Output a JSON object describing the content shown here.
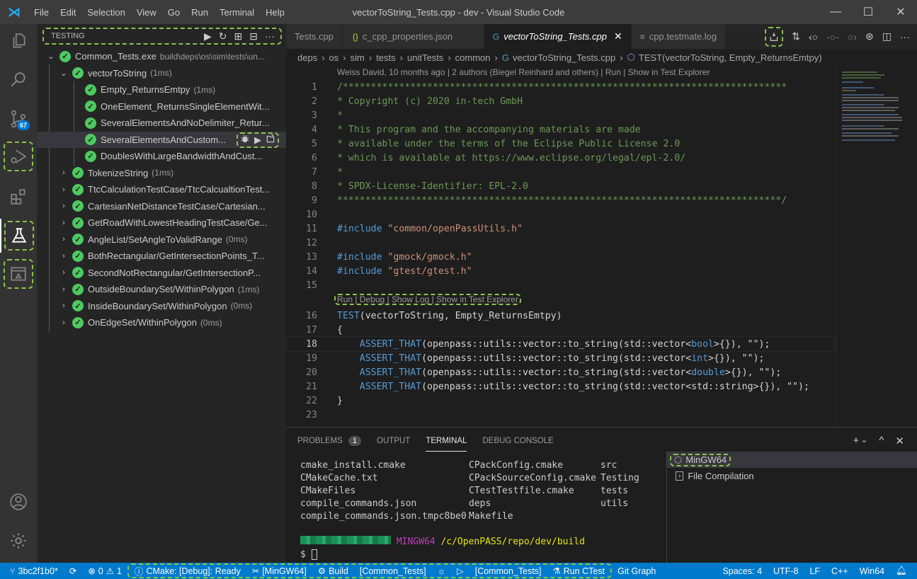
{
  "titlebar": {
    "menu": [
      "File",
      "Edit",
      "Selection",
      "View",
      "Go",
      "Run",
      "Terminal",
      "Help"
    ],
    "title": "vectorToString_Tests.cpp - dev - Visual Studio Code",
    "controls": {
      "minimize": "—",
      "maximize": "☐",
      "close": "✕"
    }
  },
  "activitybar": {
    "items": [
      {
        "name": "explorer",
        "icon": "files-icon"
      },
      {
        "name": "search",
        "icon": "search-icon"
      },
      {
        "name": "source-control",
        "icon": "source-control-icon",
        "badge": "67"
      },
      {
        "name": "run-debug",
        "icon": "run-debug-icon"
      },
      {
        "name": "extensions",
        "icon": "extensions-icon"
      },
      {
        "name": "testing",
        "icon": "flask-icon",
        "active": true
      },
      {
        "name": "remote",
        "icon": "remote-explorer-icon"
      }
    ],
    "bottom": [
      {
        "name": "accounts",
        "icon": "account-icon"
      },
      {
        "name": "manage",
        "icon": "gear-icon"
      }
    ]
  },
  "sidebar": {
    "title": "TESTING",
    "actions": {
      "run": "▶",
      "refresh": "↻",
      "expand": "⊞",
      "collapse": "⊟",
      "more": "···"
    },
    "root": {
      "label": "Common_Tests.exe",
      "description": "build\\deps\\os\\sim\\tests\\un..."
    },
    "group": {
      "label": "vectorToString",
      "duration": "(1ms)"
    },
    "children": [
      {
        "label": "Empty_ReturnsEmtpy",
        "duration": "(1ms)"
      },
      {
        "label": "OneElement_ReturnsSingleElementWit...",
        "duration": ""
      },
      {
        "label": "SeveralElementsAndNoDelimiter_Retur...",
        "duration": ""
      },
      {
        "label": "SeveralElementsAndCustom...",
        "duration": "",
        "selected": true
      },
      {
        "label": "DoublesWithLargeBandwidthAndCust...",
        "duration": ""
      }
    ],
    "row_actions": {
      "debug": "debug-icon",
      "run": "▶",
      "goto": "go-to-file-icon"
    },
    "suites": [
      {
        "label": "TokenizeString",
        "duration": "(1ms)"
      },
      {
        "label": "TtcCalculationTestCase/TtcCalcualtionTest...",
        "duration": ""
      },
      {
        "label": "CartesianNetDistanceTestCase/Cartesian...",
        "duration": ""
      },
      {
        "label": "GetRoadWithLowestHeadingTestCase/Ge...",
        "duration": ""
      },
      {
        "label": "AngleList/SetAngleToValidRange",
        "duration": "(0ms)"
      },
      {
        "label": "BothRectangular/GetIntersectionPoints_T...",
        "duration": ""
      },
      {
        "label": "SecondNotRectangular/GetIntersectionP...",
        "duration": ""
      },
      {
        "label": "OutsideBoundarySet/WithinPolygon",
        "duration": "(1ms)"
      },
      {
        "label": "InsideBoundarySet/WithinPolygon",
        "duration": "(0ms)"
      },
      {
        "label": "OnEdgeSet/WithinPolygon",
        "duration": "(0ms)"
      }
    ]
  },
  "tabs": [
    {
      "label": "Tests.cpp",
      "icon": "",
      "active": false
    },
    {
      "label": "c_cpp_properties.json",
      "icon": "{}",
      "active": false
    },
    {
      "label": "vectorToString_Tests.cpp",
      "icon": "G",
      "active": true,
      "close": "✕"
    },
    {
      "label": "cpp.testmate.log",
      "icon": "≡",
      "active": false
    }
  ],
  "editor_actions": [
    "test-coverage-icon",
    "compare-changes-icon",
    "git-previous-icon",
    "git-circle-icon",
    "git-next-icon",
    "git-graph-icon",
    "split-editor-icon",
    "more-icon"
  ],
  "breadcrumb": [
    "deps",
    "os",
    "sim",
    "tests",
    "unitTests",
    "common",
    "vectorToString_Tests.cpp",
    "TEST(vectorToString, Empty_ReturnsEmtpy)"
  ],
  "codelens_top": "Weiss David, 10 months ago | 2 authors (Biegel Reinhard and others) | Run | Show in Test Explorer",
  "codelens_test": "Run | Debug | Show Log | Show in Test Explorer",
  "code": {
    "current_line": 18,
    "lines": [
      {
        "n": "1",
        "t": "/*******************************************************************************"
      },
      {
        "n": "2",
        "t": "* Copyright (c) 2020 in-tech GmbH"
      },
      {
        "n": "3",
        "t": "*"
      },
      {
        "n": "4",
        "t": "* This program and the accompanying materials are made"
      },
      {
        "n": "5",
        "t": "* available under the terms of the Eclipse Public License 2.0"
      },
      {
        "n": "6",
        "t": "* which is available at https://www.eclipse.org/legal/epl-2.0/"
      },
      {
        "n": "7",
        "t": "*"
      },
      {
        "n": "8",
        "t": "* SPDX-License-Identifier: EPL-2.0"
      },
      {
        "n": "9",
        "t": "*******************************************************************************/"
      },
      {
        "n": "10",
        "t": ""
      },
      {
        "n": "11",
        "inc": "#include",
        "str": "\"common/openPassUtils.h\""
      },
      {
        "n": "12",
        "t": ""
      },
      {
        "n": "13",
        "inc": "#include",
        "str": "\"gmock/gmock.h\""
      },
      {
        "n": "14",
        "inc": "#include",
        "str": "\"gtest/gtest.h\""
      },
      {
        "n": "15",
        "t": ""
      },
      {
        "n": "16",
        "macro": "TEST",
        "rest": "(vectorToString, Empty_ReturnsEmtpy)"
      },
      {
        "n": "17",
        "plain": "{"
      },
      {
        "n": "18",
        "assert": "ASSERT_THAT",
        "a": "(openpass::utils::vector::to_string(std::vector<",
        "type": "bool",
        "b": ">{}), \"\");"
      },
      {
        "n": "19",
        "assert": "ASSERT_THAT",
        "a": "(openpass::utils::vector::to_string(std::vector<",
        "type": "int",
        "b": ">{}), \"\");"
      },
      {
        "n": "20",
        "assert": "ASSERT_THAT",
        "a": "(openpass::utils::vector::to_string(std::vector<",
        "type": "double",
        "b": ">{}), \"\");"
      },
      {
        "n": "21",
        "assert": "ASSERT_THAT",
        "a": "(openpass::utils::vector::to_string(std::vector<std::string>{}), \"\");",
        "type": "",
        "b": ""
      },
      {
        "n": "22",
        "plain": "}"
      },
      {
        "n": "23",
        "t": ""
      }
    ]
  },
  "panel": {
    "tabs": [
      {
        "label": "PROBLEMS",
        "count": "1"
      },
      {
        "label": "OUTPUT"
      },
      {
        "label": "TERMINAL",
        "active": true
      },
      {
        "label": "DEBUG CONSOLE"
      }
    ],
    "actions": {
      "new": "+",
      "dropdown": "⌄",
      "maximize": "^",
      "close": "✕"
    },
    "terminal": {
      "col1": [
        "cmake_install.cmake",
        "CMakeCache.txt",
        "CMakeFiles",
        "compile_commands.json",
        "compile_commands.json.tmpc8be0"
      ],
      "col2": [
        "CPackConfig.cmake",
        "CPackSourceConfig.cmake",
        "CTestTestfile.cmake",
        "deps",
        "Makefile"
      ],
      "col3": [
        "src",
        "Testing",
        "tests",
        "utils"
      ],
      "prompt_env": "MINGW64",
      "prompt_path": "/c/OpenPASS/repo/dev/build",
      "prompt_symbol": "$"
    },
    "terminals": [
      {
        "label": "MinGW64",
        "icon": "terminal-box-icon",
        "selected": true
      },
      {
        "label": "File Compilation",
        "icon": "task-icon"
      }
    ]
  },
  "statusbar": {
    "branch": "3bc2f1b0*",
    "errors": "0",
    "warnings": "1",
    "cmake_status": "CMake: [Debug]: Ready",
    "kit": "[MinGW64]",
    "build": "Build",
    "build_target": "[Common_Tests]",
    "launch_target": "[Common_Tests]",
    "run_ctest": "Run CTest",
    "git_graph": "Git Graph",
    "spaces": "Spaces: 4",
    "encoding": "UTF-8",
    "eol": "LF",
    "language": "C++",
    "platform": "Win64"
  },
  "colors": {
    "accent": "#007acc",
    "pass": "#4ec95f",
    "highlight": "#8bc34a"
  }
}
